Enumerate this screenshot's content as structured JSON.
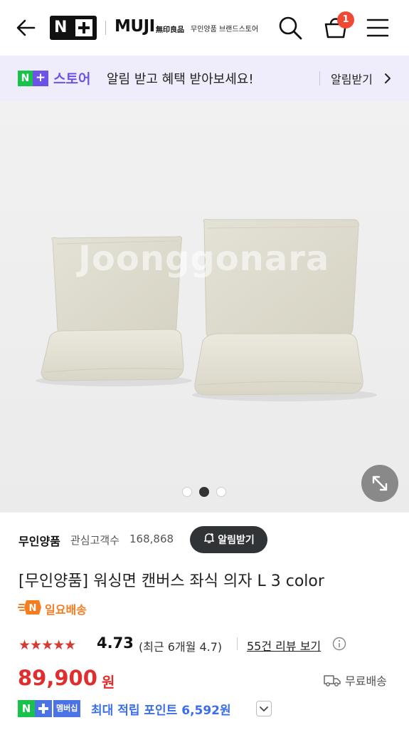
{
  "header": {
    "brand_name": "MUJI",
    "brand_sub": "無印良品",
    "brand_store": "무인양품 브랜드스토어",
    "cart_count": "1",
    "icons": [
      "back-arrow-icon",
      "search-icon",
      "cart-icon",
      "menu-icon"
    ]
  },
  "promo_banner": {
    "logo_n": "N",
    "logo_plus": "+",
    "store_label": "스토어",
    "message": "알림 받고 혜택 받아보세요!",
    "action": "알림받기"
  },
  "gallery": {
    "watermark": "Joonggonara",
    "total_images": 3,
    "active_index": 2
  },
  "store": {
    "name": "무인양품",
    "fans_label": "관심고객수",
    "fans_count": "168,868",
    "alarm_button": "알림받기"
  },
  "product": {
    "title": "[무인양품] 워싱면 캔버스 좌식 의자 L 3 color",
    "delivery_badge": "일요배송",
    "stars": "★★★★★",
    "rating": "4.73",
    "recent_rating": "(최근 6개월 4.7)",
    "review_link": "55건 리뷰 보기",
    "price": "89,900",
    "price_unit": "원",
    "shipping": "무료배송"
  },
  "membership": {
    "badge_n": "N",
    "badge_label": "멤버십",
    "points_text": "최대 적립 포인트 6,592원"
  },
  "colors": {
    "accent_purple": "#6f52e8",
    "banner_bg": "#efedfb",
    "price_red": "#e02e2e",
    "naver_green": "#19c24a",
    "points_blue": "#3a6fe8",
    "delivery_orange": "#f57c1f"
  }
}
